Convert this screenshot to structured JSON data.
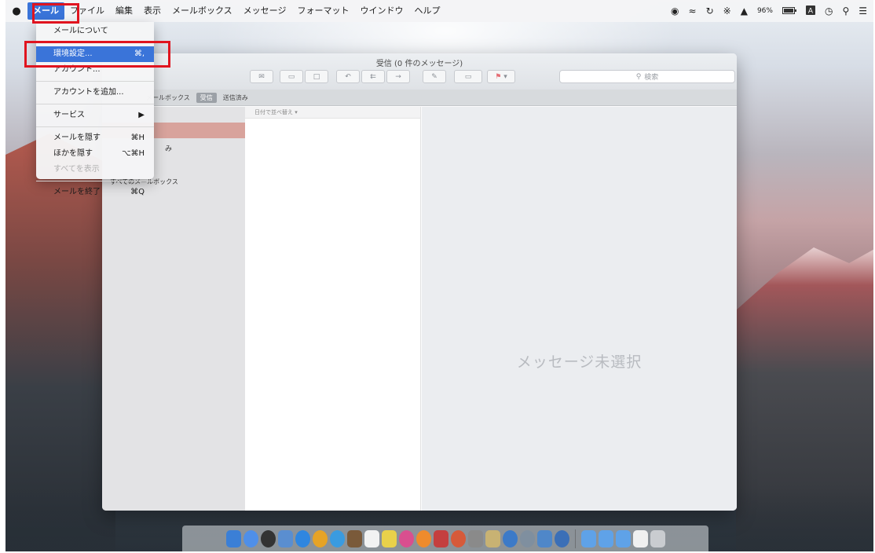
{
  "menubar": {
    "apple_icon": "",
    "items": [
      "メール",
      "ファイル",
      "編集",
      "表示",
      "メールボックス",
      "メッセージ",
      "フォーマット",
      "ウインドウ",
      "ヘルプ"
    ],
    "status": {
      "battery_percent": "96%",
      "icons": [
        "record-icon",
        "wifi-icon",
        "time-machine-icon",
        "bluetooth-icon",
        "volume-icon",
        "battery-icon",
        "input-source-icon",
        "clock-icon",
        "spotlight-icon",
        "notification-center-icon"
      ]
    }
  },
  "mail_menu": {
    "items": [
      {
        "label": "メールについて",
        "shortcut": "",
        "state": "normal"
      },
      {
        "label": "環境設定...",
        "shortcut": "⌘,",
        "state": "selected"
      },
      {
        "label": "アカウント...",
        "shortcut": "",
        "state": "normal"
      },
      {
        "label": "アカウントを追加...",
        "shortcut": "",
        "state": "normal"
      },
      {
        "label": "サービス",
        "shortcut": "▶",
        "state": "normal"
      },
      {
        "label": "メールを隠す",
        "shortcut": "⌘H",
        "state": "normal"
      },
      {
        "label": "ほかを隠す",
        "shortcut": "⌥⌘H",
        "state": "normal"
      },
      {
        "label": "すべてを表示",
        "shortcut": "",
        "state": "disabled"
      },
      {
        "label": "メールを終了",
        "shortcut": "⌘Q",
        "state": "normal"
      }
    ]
  },
  "mail_window": {
    "title": "受信 (0 件のメッセージ)",
    "search_placeholder": "検索",
    "favorites_bar": {
      "mailboxes_label": "メールボックス",
      "inbox_tag": "受信",
      "sent_label": "送信済み"
    },
    "sidebar": {
      "partial_sent": "み",
      "all_mailboxes": "すべてのメールボックス"
    },
    "sort_label": "日付で並べ替え",
    "no_message_text": "メッセージ未選択"
  },
  "colors": {
    "accent": "#3a74d9",
    "highlight_box": "#e0141f",
    "sidebar_selection": "#d8a39c"
  }
}
